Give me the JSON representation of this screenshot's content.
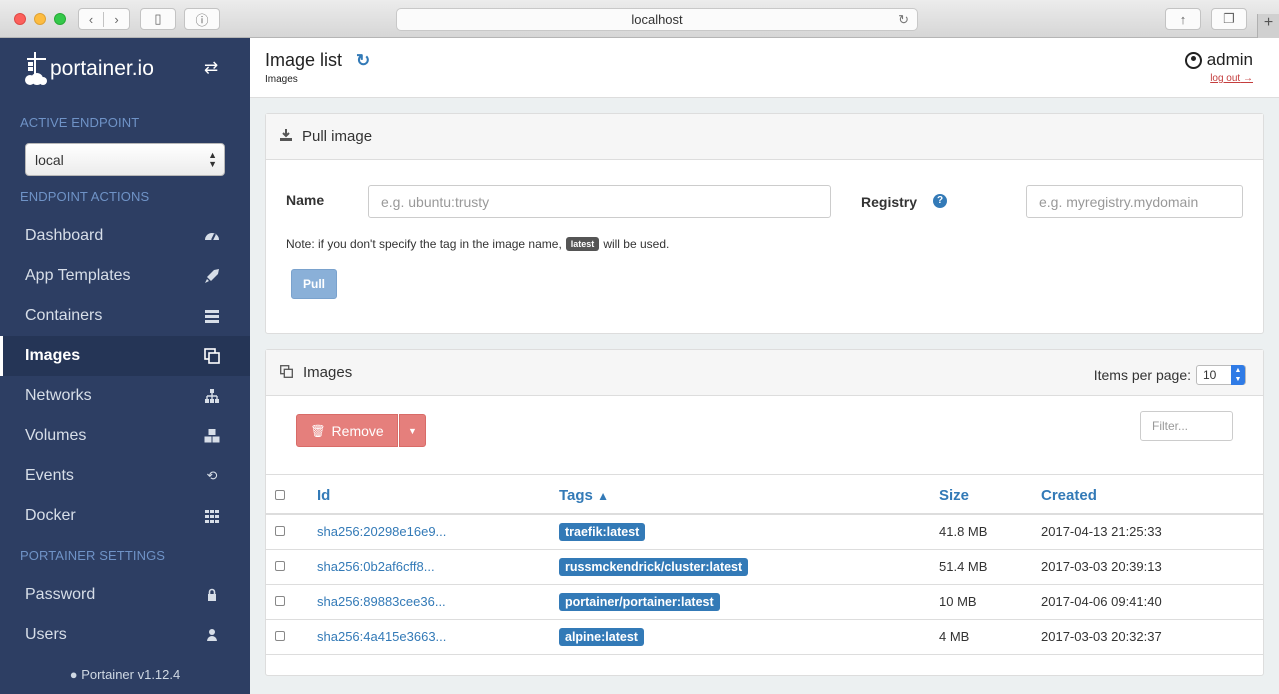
{
  "browser": {
    "url": "localhost",
    "back_icon": "chevron-left-icon",
    "forward_icon": "chevron-right-icon"
  },
  "sidebar": {
    "logo_text": "portainer.io",
    "active_endpoint_title": "ACTIVE ENDPOINT",
    "endpoint_value": "local",
    "endpoint_actions_title": "ENDPOINT ACTIONS",
    "items": [
      {
        "label": "Dashboard",
        "icon": "tachometer-icon"
      },
      {
        "label": "App Templates",
        "icon": "rocket-icon"
      },
      {
        "label": "Containers",
        "icon": "server-icon"
      },
      {
        "label": "Images",
        "icon": "clone-icon"
      },
      {
        "label": "Networks",
        "icon": "sitemap-icon"
      },
      {
        "label": "Volumes",
        "icon": "cubes-icon"
      },
      {
        "label": "Events",
        "icon": "history-icon"
      },
      {
        "label": "Docker",
        "icon": "th-icon"
      }
    ],
    "settings_title": "PORTAINER SETTINGS",
    "settings_items": [
      {
        "label": "Password",
        "icon": "lock-icon"
      },
      {
        "label": "Users",
        "icon": "user-icon"
      }
    ],
    "version": "Portainer v1.12.4"
  },
  "header": {
    "title": "Image list",
    "breadcrumb": "Images",
    "username": "admin",
    "logout": "log out"
  },
  "pull": {
    "title": "Pull image",
    "name_label": "Name",
    "name_placeholder": "e.g. ubuntu:trusty",
    "registry_label": "Registry",
    "registry_placeholder": "e.g. myregistry.mydomain",
    "note_before": "Note: if you don't specify the tag in the image name,",
    "note_tag": "latest",
    "note_after": "will be used.",
    "button": "Pull"
  },
  "images": {
    "title": "Images",
    "items_per_page_label": "Items per page:",
    "items_per_page": "10",
    "remove_label": "Remove",
    "filter_placeholder": "Filter...",
    "columns": {
      "id": "Id",
      "tags": "Tags",
      "size": "Size",
      "created": "Created"
    },
    "rows": [
      {
        "id": "sha256:20298e16e9...",
        "tag": "traefik:latest",
        "size": "41.8 MB",
        "created": "2017-04-13 21:25:33"
      },
      {
        "id": "sha256:0b2af6cff8...",
        "tag": "russmckendrick/cluster:latest",
        "size": "51.4 MB",
        "created": "2017-03-03 20:39:13"
      },
      {
        "id": "sha256:89883cee36...",
        "tag": "portainer/portainer:latest",
        "size": "10 MB",
        "created": "2017-04-06 09:41:40"
      },
      {
        "id": "sha256:4a415e3663...",
        "tag": "alpine:latest",
        "size": "4 MB",
        "created": "2017-03-03 20:32:37"
      }
    ]
  }
}
